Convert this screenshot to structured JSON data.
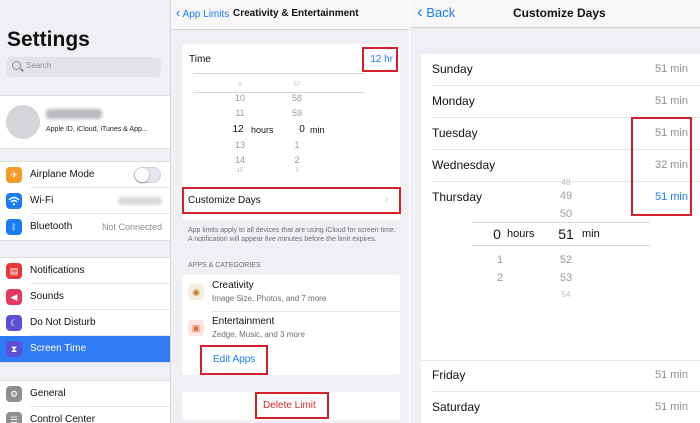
{
  "settings": {
    "title": "Settings",
    "search_placeholder": "Search",
    "profile_subtitle": "Apple ID, iCloud, iTunes & App...",
    "rows": [
      {
        "label": "Airplane Mode",
        "icon": "airplane-icon",
        "color": "#f39a2b"
      },
      {
        "label": "Wi-Fi",
        "icon": "wifi-icon",
        "color": "#1a7cf5"
      },
      {
        "label": "Bluetooth",
        "icon": "bluetooth-icon",
        "color": "#1a7cf5",
        "value": "Not Connected"
      },
      {
        "label": "Notifications",
        "icon": "notifications-icon",
        "color": "#e5383b"
      },
      {
        "label": "Sounds",
        "icon": "sounds-icon",
        "color": "#e5395b"
      },
      {
        "label": "Do Not Disturb",
        "icon": "moon-icon",
        "color": "#5b4fd3"
      },
      {
        "label": "Screen Time",
        "icon": "hourglass-icon",
        "color": "#5b4fd3"
      },
      {
        "label": "General",
        "icon": "gear-icon",
        "color": "#8e8e93"
      },
      {
        "label": "Control Center",
        "icon": "control-center-icon",
        "color": "#8e8e93"
      }
    ]
  },
  "app_limits": {
    "back": "App Limits",
    "title": "Creativity & Entertainment",
    "time_label": "Time",
    "time_value": "12 hr",
    "picker_hours": [
      "10",
      "11",
      "12",
      "13",
      "14"
    ],
    "picker_minutes": [
      "58",
      "59",
      "0",
      "1",
      "2"
    ],
    "picker_faint_hours": [
      "9",
      "15"
    ],
    "picker_faint_minutes": [
      "57",
      "3"
    ],
    "hours_label": "hours",
    "min_label": "min",
    "customize_label": "Customize Days",
    "note": "App limits apply to all devices that are using iCloud for screen time. A notification will appear five minutes before the limit expires.",
    "section": "APPS & CATEGORIES",
    "apps": [
      {
        "name": "Creativity",
        "sub": "Image Size, Photos, and 7 more"
      },
      {
        "name": "Entertainment",
        "sub": "Zedge, Music, and 3 more"
      }
    ],
    "edit_apps": "Edit Apps",
    "delete_limit": "Delete Limit"
  },
  "customize_days": {
    "back": "Back",
    "title": "Customize Days",
    "days_top": [
      {
        "day": "Sunday",
        "value": "51 min"
      },
      {
        "day": "Monday",
        "value": "51 min"
      },
      {
        "day": "Tuesday",
        "value": "51 min"
      },
      {
        "day": "Wednesday",
        "value": "32 min"
      },
      {
        "day": "Thursday",
        "value": "51 min"
      }
    ],
    "days_bottom": [
      {
        "day": "Friday",
        "value": "51 min"
      },
      {
        "day": "Saturday",
        "value": "51 min"
      }
    ],
    "picker_hours": [
      "0",
      "1",
      "2"
    ],
    "picker_minutes": [
      "49",
      "50",
      "51",
      "52",
      "53"
    ],
    "picker_faint_minutes": [
      "48",
      "54"
    ],
    "hours_label": "hours",
    "min_label": "min"
  },
  "colors": {
    "accent": "#1a7cf5",
    "highlight_box": "#d3202a",
    "delete": "#e0282a",
    "selected_row": "#2f7cf6"
  }
}
